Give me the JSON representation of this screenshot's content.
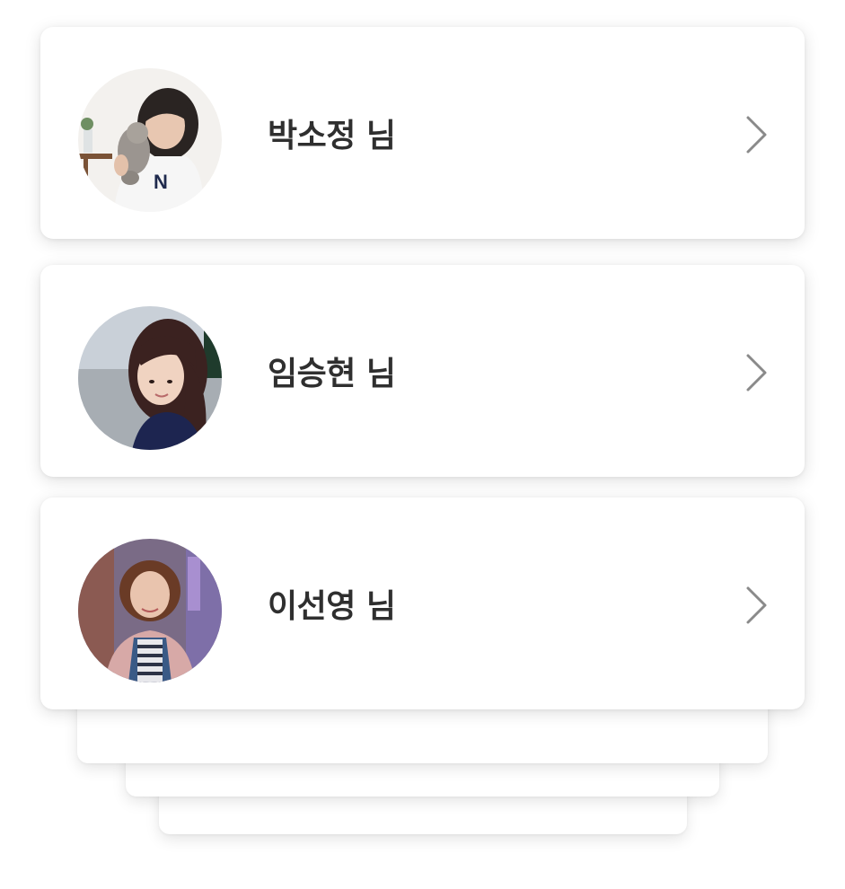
{
  "users": [
    {
      "name": "박소정 님",
      "avatar_icon": "avatar-photo-icon",
      "chevron_icon": "chevron-right-icon"
    },
    {
      "name": "임승현 님",
      "avatar_icon": "avatar-photo-icon",
      "chevron_icon": "chevron-right-icon"
    },
    {
      "name": "이선영 님",
      "avatar_icon": "avatar-photo-icon",
      "chevron_icon": "chevron-right-icon"
    }
  ],
  "colors": {
    "card_background": "#ffffff",
    "name_text": "#2f2f2f",
    "chevron": "#8a8a8a"
  }
}
